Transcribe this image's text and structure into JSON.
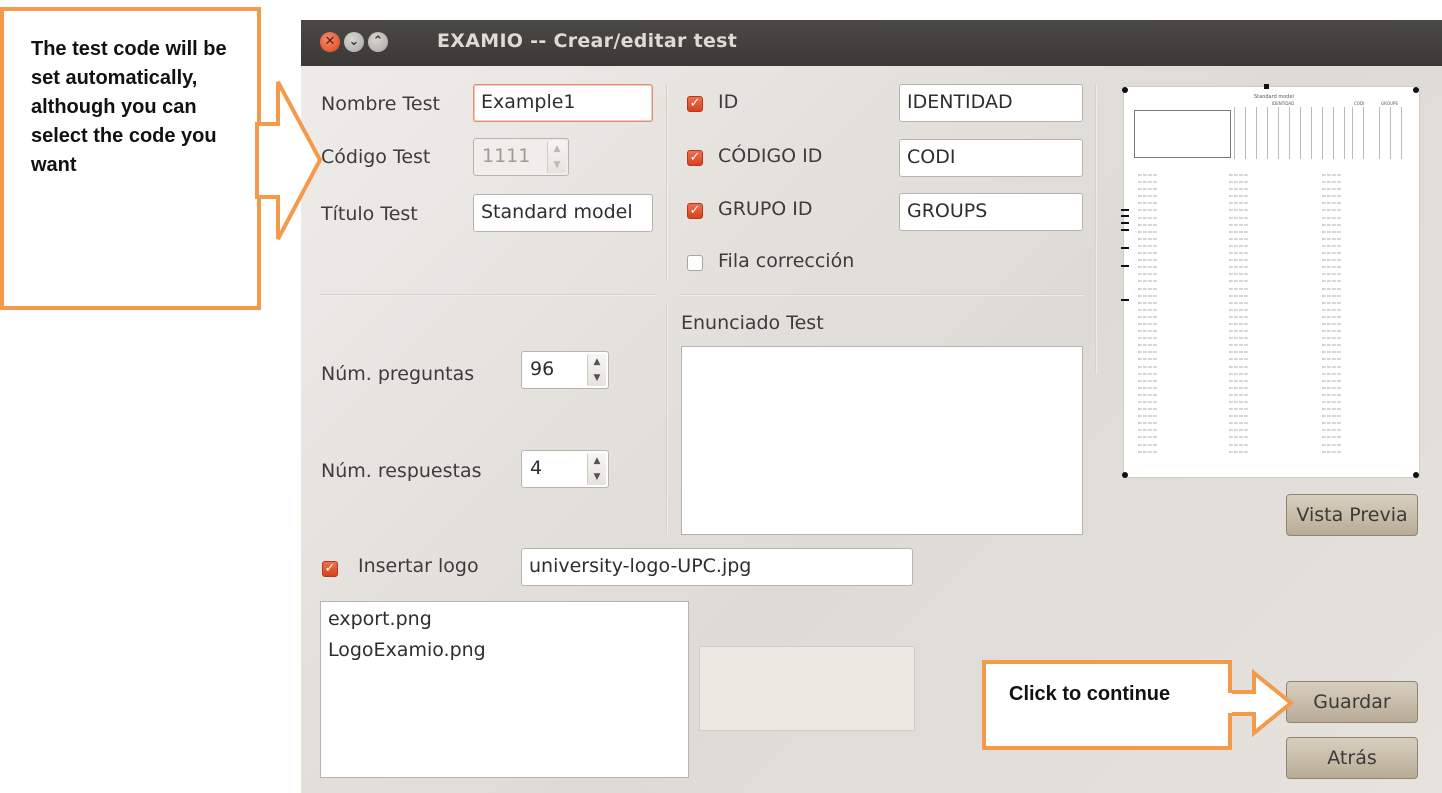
{
  "window": {
    "title": "EXAMIO  -- Crear/editar test"
  },
  "form": {
    "nombre_label": "Nombre Test",
    "nombre_value": "Example1",
    "codigo_label": "Código Test",
    "codigo_value": "1111",
    "titulo_label": "Título Test",
    "titulo_value": "Standard model"
  },
  "ids": [
    {
      "checked": true,
      "label": "ID",
      "value": "IDENTIDAD"
    },
    {
      "checked": true,
      "label": "CÓDIGO ID",
      "value": "CODI"
    },
    {
      "checked": true,
      "label": "GRUPO ID",
      "value": "GROUPS"
    }
  ],
  "fila_correccion": {
    "checked": false,
    "label": "Fila corrección"
  },
  "preguntas": {
    "label": "Núm. preguntas",
    "value": "96"
  },
  "respuestas": {
    "label": "Núm. respuestas",
    "value": "4"
  },
  "enunciado": {
    "label": "Enunciado Test",
    "value": ""
  },
  "logo": {
    "checked": true,
    "label": "Insertar logo",
    "file": "university-logo-UPC.jpg",
    "files": [
      "export.png",
      "LogoExamio.png"
    ]
  },
  "buttons": {
    "preview": "Vista Previa",
    "save": "Guardar",
    "back": "Atrás"
  },
  "preview_sheet": {
    "title": "Standard model",
    "cols": [
      "IDENTIDAD",
      "CODI",
      "GROUPS"
    ]
  },
  "annotations": {
    "left_note": "The test code will be set automatically, although you can select the code you want",
    "bottom_note": "Click to continue",
    "accent": "#f39b4a"
  }
}
